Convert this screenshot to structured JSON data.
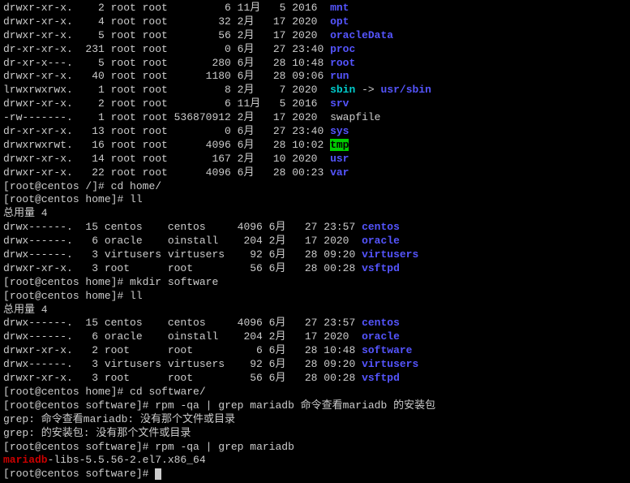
{
  "ls_root": [
    {
      "perm": "drwxr-xr-x.",
      "links": "2",
      "owner": "root",
      "group": "root",
      "size": "6",
      "month": "11月",
      "day": "5",
      "timeyear": "2016",
      "name": "mnt",
      "color": "blue"
    },
    {
      "perm": "drwxr-xr-x.",
      "links": "4",
      "owner": "root",
      "group": "root",
      "size": "32",
      "month": "2月",
      "day": "17",
      "timeyear": "2020",
      "name": "opt",
      "color": "blue"
    },
    {
      "perm": "drwxr-xr-x.",
      "links": "5",
      "owner": "root",
      "group": "root",
      "size": "56",
      "month": "2月",
      "day": "17",
      "timeyear": "2020",
      "name": "oracleData",
      "color": "blue"
    },
    {
      "perm": "dr-xr-xr-x.",
      "links": "231",
      "owner": "root",
      "group": "root",
      "size": "0",
      "month": "6月",
      "day": "27",
      "timeyear": "23:40",
      "name": "proc",
      "color": "blue"
    },
    {
      "perm": "dr-xr-x---.",
      "links": "5",
      "owner": "root",
      "group": "root",
      "size": "280",
      "month": "6月",
      "day": "28",
      "timeyear": "10:48",
      "name": "root",
      "color": "blue"
    },
    {
      "perm": "drwxr-xr-x.",
      "links": "40",
      "owner": "root",
      "group": "root",
      "size": "1180",
      "month": "6月",
      "day": "28",
      "timeyear": "09:06",
      "name": "run",
      "color": "blue"
    },
    {
      "perm": "lrwxrwxrwx.",
      "links": "1",
      "owner": "root",
      "group": "root",
      "size": "8",
      "month": "2月",
      "day": "7",
      "timeyear": "2020",
      "name": "sbin",
      "color": "cyan",
      "arrow": " -> ",
      "target": "usr/sbin",
      "targetcolor": "blue"
    },
    {
      "perm": "drwxr-xr-x.",
      "links": "2",
      "owner": "root",
      "group": "root",
      "size": "6",
      "month": "11月",
      "day": "5",
      "timeyear": "2016",
      "name": "srv",
      "color": "blue"
    },
    {
      "perm": "-rw-------.",
      "links": "1",
      "owner": "root",
      "group": "root",
      "size": "536870912",
      "month": "2月",
      "day": "17",
      "timeyear": "2020",
      "name": "swapfile",
      "color": "white"
    },
    {
      "perm": "dr-xr-xr-x.",
      "links": "13",
      "owner": "root",
      "group": "root",
      "size": "0",
      "month": "6月",
      "day": "27",
      "timeyear": "23:40",
      "name": "sys",
      "color": "blue"
    },
    {
      "perm": "drwxrwxrwt.",
      "links": "16",
      "owner": "root",
      "group": "root",
      "size": "4096",
      "month": "6月",
      "day": "28",
      "timeyear": "10:02",
      "name": "tmp",
      "color": "hl"
    },
    {
      "perm": "drwxr-xr-x.",
      "links": "14",
      "owner": "root",
      "group": "root",
      "size": "167",
      "month": "2月",
      "day": "10",
      "timeyear": "2020",
      "name": "usr",
      "color": "blue"
    },
    {
      "perm": "drwxr-xr-x.",
      "links": "22",
      "owner": "root",
      "group": "root",
      "size": "4096",
      "month": "6月",
      "day": "28",
      "timeyear": "00:23",
      "name": "var",
      "color": "blue"
    }
  ],
  "prompt1": {
    "user": "root",
    "host": "centos",
    "dir": "/",
    "cmd": "cd home/"
  },
  "prompt2": {
    "user": "root",
    "host": "centos",
    "dir": "home",
    "cmd": "ll"
  },
  "total_label": "总用量 4",
  "ls_home1": [
    {
      "perm": "drwx------.",
      "links": "15",
      "owner": "centos",
      "group": "centos",
      "size": "4096",
      "month": "6月",
      "day": "27",
      "timeyear": "23:57",
      "name": "centos",
      "color": "blue"
    },
    {
      "perm": "drwx------.",
      "links": "6",
      "owner": "oracle",
      "group": "oinstall",
      "size": "204",
      "month": "2月",
      "day": "17",
      "timeyear": "2020",
      "name": "oracle",
      "color": "blue"
    },
    {
      "perm": "drwx------.",
      "links": "3",
      "owner": "virtusers",
      "group": "virtusers",
      "size": "92",
      "month": "6月",
      "day": "28",
      "timeyear": "09:20",
      "name": "virtusers",
      "color": "blue"
    },
    {
      "perm": "drwxr-xr-x.",
      "links": "3",
      "owner": "root",
      "group": "root",
      "size": "56",
      "month": "6月",
      "day": "28",
      "timeyear": "00:28",
      "name": "vsftpd",
      "color": "blue"
    }
  ],
  "prompt3": {
    "user": "root",
    "host": "centos",
    "dir": "home",
    "cmd": "mkdir software"
  },
  "prompt4": {
    "user": "root",
    "host": "centos",
    "dir": "home",
    "cmd": "ll"
  },
  "ls_home2": [
    {
      "perm": "drwx------.",
      "links": "15",
      "owner": "centos",
      "group": "centos",
      "size": "4096",
      "month": "6月",
      "day": "27",
      "timeyear": "23:57",
      "name": "centos",
      "color": "blue"
    },
    {
      "perm": "drwx------.",
      "links": "6",
      "owner": "oracle",
      "group": "oinstall",
      "size": "204",
      "month": "2月",
      "day": "17",
      "timeyear": "2020",
      "name": "oracle",
      "color": "blue"
    },
    {
      "perm": "drwxr-xr-x.",
      "links": "2",
      "owner": "root",
      "group": "root",
      "size": "6",
      "month": "6月",
      "day": "28",
      "timeyear": "10:48",
      "name": "software",
      "color": "blue"
    },
    {
      "perm": "drwx------.",
      "links": "3",
      "owner": "virtusers",
      "group": "virtusers",
      "size": "92",
      "month": "6月",
      "day": "28",
      "timeyear": "09:20",
      "name": "virtusers",
      "color": "blue"
    },
    {
      "perm": "drwxr-xr-x.",
      "links": "3",
      "owner": "root",
      "group": "root",
      "size": "56",
      "month": "6月",
      "day": "28",
      "timeyear": "00:28",
      "name": "vsftpd",
      "color": "blue"
    }
  ],
  "prompt5": {
    "user": "root",
    "host": "centos",
    "dir": "home",
    "cmd": "cd software/"
  },
  "prompt6": {
    "user": "root",
    "host": "centos",
    "dir": "software",
    "cmd": "rpm -qa | grep mariadb 命令查看mariadb 的安装包"
  },
  "grep_err1": "grep: 命令查看mariadb: 没有那个文件或目录",
  "grep_err2": "grep: 的安装包: 没有那个文件或目录",
  "prompt7": {
    "user": "root",
    "host": "centos",
    "dir": "software",
    "cmd": "rpm -qa | grep mariadb"
  },
  "rpm_result_prefix": "mariadb",
  "rpm_result_suffix": "-libs-5.5.56-2.el7.x86_64",
  "prompt8": {
    "user": "root",
    "host": "centos",
    "dir": "software",
    "cmd": ""
  }
}
